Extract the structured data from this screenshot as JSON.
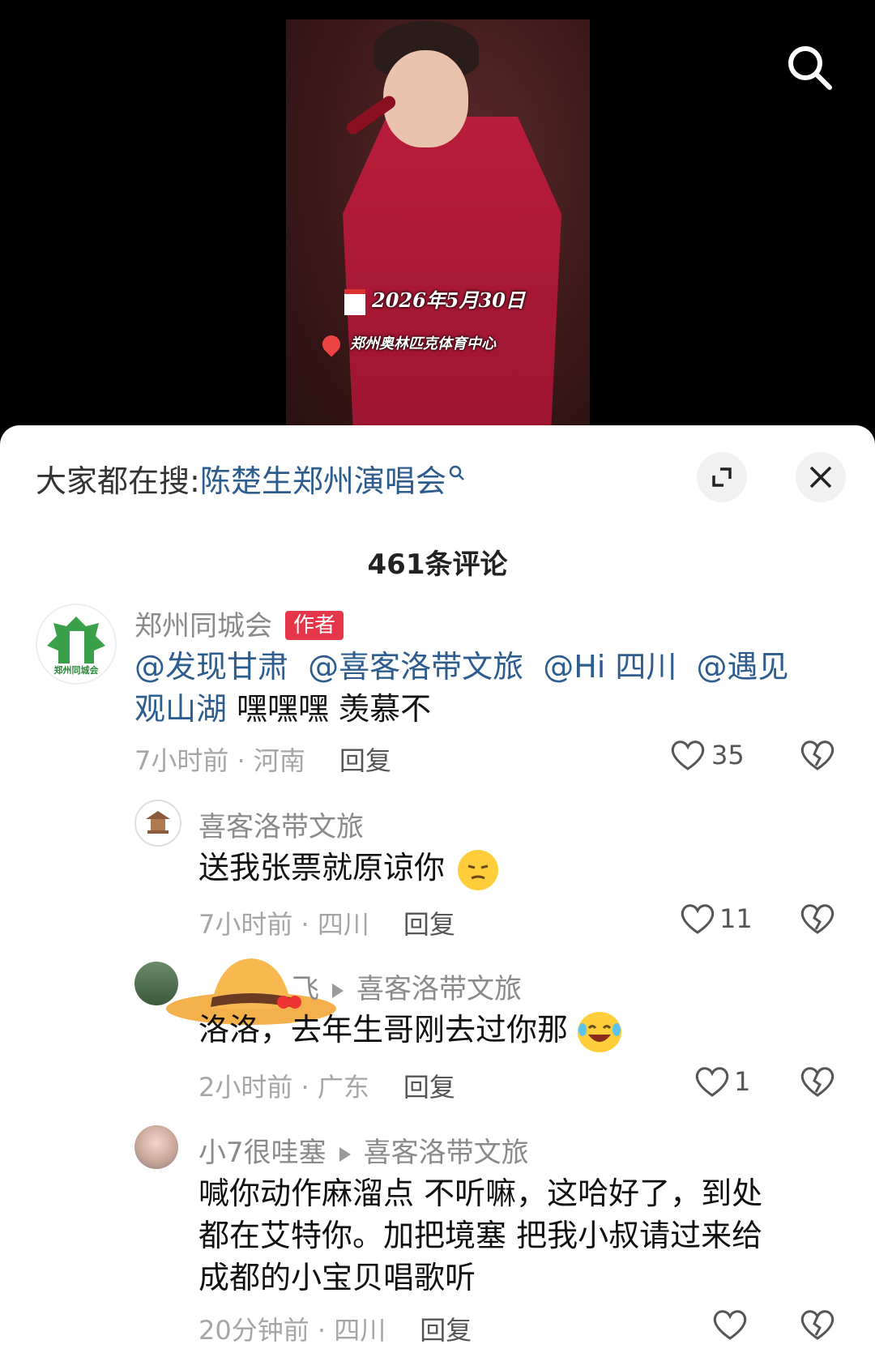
{
  "video": {
    "date_text": "2026年5月30日",
    "venue_text": "郑州奥林匹克体育中心"
  },
  "sheet": {
    "hot_prefix": "大家都在搜:",
    "hot_term": "陈楚生郑州演唱会",
    "comment_count": "461条评论"
  },
  "comments": [
    {
      "name": "郑州同城会",
      "badge": "作者",
      "avatar_text": "郑州同城会",
      "mentions": [
        "@发现甘肃",
        "@喜客洛带文旅",
        "@Hi 四川",
        "@遇见"
      ],
      "line2_mention": "观山湖",
      "line2_text": " 嘿嘿嘿 羡慕不",
      "time": "7小时前 · 河南",
      "reply": "回复",
      "likes": "35"
    },
    {
      "name": "喜客洛带文旅",
      "text": "送我张票就原谅你",
      "time": "7小时前 · 四川",
      "reply": "回复",
      "likes": "11"
    },
    {
      "name_partial": "飞",
      "reply_to": "喜客洛带文旅",
      "text": "洛洛，去年生哥刚去过你那",
      "time": "2小时前 · 广东",
      "reply": "回复",
      "likes": "1"
    },
    {
      "name": "小7很哇塞",
      "reply_to": "喜客洛带文旅",
      "text_line1": "喊你动作麻溜点 不听嘛，这哈好了，到处",
      "text_line2": "都在艾特你。加把境塞 把我小叔请过来给",
      "text_line3": "成都的小宝贝唱歌听",
      "time": "20分钟前 · 四川",
      "reply": "回复",
      "likes": ""
    }
  ]
}
